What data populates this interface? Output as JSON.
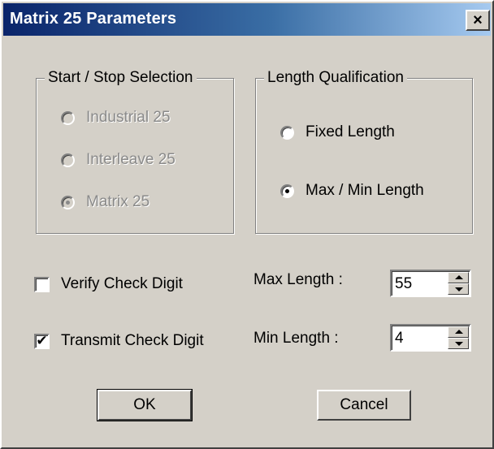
{
  "window": {
    "title": "Matrix 25 Parameters",
    "close_glyph": "×"
  },
  "start_stop": {
    "legend": "Start / Stop Selection",
    "enabled": false,
    "options": [
      {
        "label": "Industrial 25",
        "selected": false
      },
      {
        "label": "Interleave 25",
        "selected": false
      },
      {
        "label": "Matrix 25",
        "selected": true
      }
    ]
  },
  "length_qualification": {
    "legend": "Length Qualification",
    "options": [
      {
        "label": "Fixed Length",
        "selected": false
      },
      {
        "label": "Max / Min Length",
        "selected": true
      }
    ]
  },
  "checks": {
    "verify": {
      "label": "Verify Check Digit",
      "checked": false
    },
    "transmit": {
      "label": "Transmit Check Digit",
      "checked": true,
      "mark": "✔"
    }
  },
  "lengths": {
    "max_label": "Max Length :",
    "max_value": "55",
    "min_label": "Min Length :",
    "min_value": "4"
  },
  "buttons": {
    "ok": "OK",
    "cancel": "Cancel"
  }
}
